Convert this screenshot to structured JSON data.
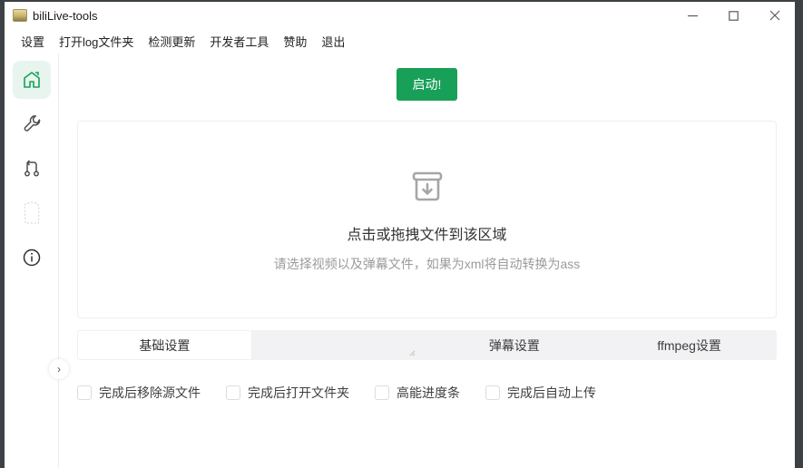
{
  "titlebar": {
    "title": "biliLive-tools",
    "controls": {
      "minimize": "minimize",
      "maximize": "maximize",
      "close": "close"
    }
  },
  "menubar": {
    "items": [
      {
        "label": "设置"
      },
      {
        "label": "打开log文件夹"
      },
      {
        "label": "检测更新"
      },
      {
        "label": "开发者工具"
      },
      {
        "label": "赞助"
      },
      {
        "label": "退出"
      }
    ]
  },
  "sidebar": {
    "items": [
      {
        "icon": "home-icon",
        "active": true
      },
      {
        "icon": "wrench-icon",
        "active": false
      },
      {
        "icon": "merge-icon",
        "active": false
      },
      {
        "icon": "clip-outline-icon",
        "active": false
      },
      {
        "icon": "info-icon",
        "active": false
      }
    ],
    "collapse_toggle": "›"
  },
  "main": {
    "start_button": "启动!",
    "dropzone": {
      "icon": "archive-download-icon",
      "title": "点击或拖拽文件到该区域",
      "subtitle": "请选择视频以及弹幕文件，如果为xml将自动转换为ass"
    },
    "tabs": [
      {
        "label": "基础设置",
        "active": true
      },
      {
        "label": "弹幕设置",
        "active": false
      },
      {
        "label": "ffmpeg设置",
        "active": false
      }
    ],
    "checkboxes": [
      {
        "label": "完成后移除源文件",
        "checked": false
      },
      {
        "label": "完成后打开文件夹",
        "checked": false
      },
      {
        "label": "高能进度条",
        "checked": false
      },
      {
        "label": "完成后自动上传",
        "checked": false
      }
    ]
  },
  "colors": {
    "primary_green": "#18a058",
    "primary_green_light": "#e7f5ee",
    "icon_gray": "#4d4d4d",
    "frame_dark": "#3b4144"
  }
}
